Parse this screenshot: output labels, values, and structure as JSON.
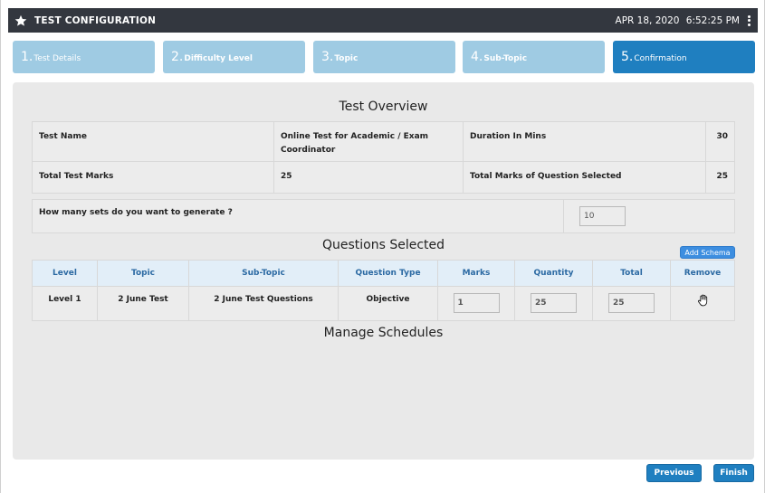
{
  "header": {
    "title": "TEST CONFIGURATION",
    "date": "APR 18, 2020",
    "time": "6:52:25 PM",
    "bg_color": "#33373f"
  },
  "steps": [
    {
      "number": "1.",
      "label": "Test Details",
      "active": false
    },
    {
      "number": "2.",
      "label": "Difficulty Level",
      "active": false
    },
    {
      "number": "3.",
      "label": "Topic",
      "active": false
    },
    {
      "number": "4.",
      "label": "Sub-Topic",
      "active": false
    },
    {
      "number": "5.",
      "label": "Confirmation",
      "active": true
    }
  ],
  "overview": {
    "heading": "Test Overview",
    "rows": [
      {
        "label1": "Test Name",
        "value1": "Online Test for Academic / Exam Coordinator",
        "label2": "Duration In Mins",
        "value2": "30"
      },
      {
        "label1": "Total Test Marks",
        "value1": "25",
        "label2": "Total Marks of Question Selected",
        "value2": "25"
      }
    ],
    "sets_question": "How many sets do you want to generate ?",
    "sets_value": "10"
  },
  "questions": {
    "heading": "Questions Selected",
    "add_schema_label": "Add Schema",
    "columns": [
      "Level",
      "Topic",
      "Sub-Topic",
      "Question Type",
      "Marks",
      "Quantity",
      "Total",
      "Remove"
    ],
    "rows": [
      {
        "level": "Level 1",
        "topic": "2 June Test",
        "subtopic": "2 June Test Questions",
        "type": "Objective",
        "marks": "1",
        "quantity": "25",
        "total": "25"
      }
    ]
  },
  "schedules": {
    "heading": "Manage Schedules"
  },
  "footer": {
    "previous_label": "Previous",
    "finish_label": "Finish"
  },
  "colors": {
    "step_inactive": "#9fcbe3",
    "step_active": "#1f7fc0",
    "table_header_text": "#2c6aa3",
    "button": "#1f7fc0"
  }
}
